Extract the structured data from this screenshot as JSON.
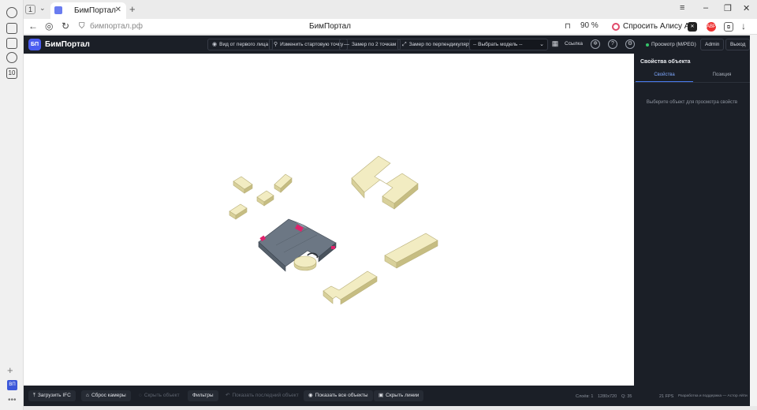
{
  "browser": {
    "tab_count": "1",
    "tab_title": "БимПортал",
    "url": "бимпортал.рф",
    "page_title": "БимПортал",
    "zoom": "90 %",
    "alice_label": "Спросить Алису AI",
    "rail_badge": "10"
  },
  "app": {
    "logo": "БП",
    "brand": "БимПортал",
    "header_buttons": {
      "first_person": "Вид от первого лица",
      "start_point": "Изменить стартовую точку",
      "measure_two": "Замер по 2 точкам",
      "measure_perp": "Замер по перпендикуляру"
    },
    "model_select": "-- Выбрать модель --",
    "link_label": "Ссылка",
    "status_label": "Просмотр (M/PEG)",
    "user_label": "Admin",
    "logout_label": "Выход",
    "status_color": "#35c46a",
    "accent_color": "#4a5cf0"
  },
  "sidepanel": {
    "title": "Свойства объекта",
    "tabs": [
      "Свойства",
      "Позиция"
    ],
    "empty_text": "Выберите объект для просмотра свойств"
  },
  "footer": {
    "buttons": {
      "load_ifc": "Загрузить IFC",
      "reset_camera": "Сброс камеры",
      "hide_object": "Скрыть объект",
      "filters": "Фильтры",
      "show_last": "Показать последний объект",
      "show_all": "Показать все объекты",
      "hide_lines": "Скрыть линии"
    },
    "stats": {
      "objects": "Слоёв: 1",
      "resolution": "1280x720",
      "quality": "Q: 35",
      "fps": "21 FPS",
      "credits": "Разработка и поддержка — Астор Айти"
    }
  }
}
